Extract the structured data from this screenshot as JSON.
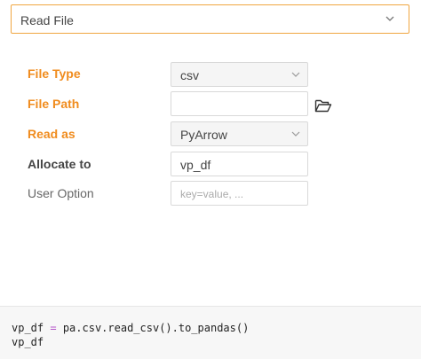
{
  "header": {
    "title": "Read File",
    "chevron_icon": "chevron-down-icon"
  },
  "form": {
    "file_type": {
      "label": "File Type",
      "value": "csv"
    },
    "file_path": {
      "label": "File Path",
      "value": "",
      "folder_icon": "folder-open-icon"
    },
    "read_as": {
      "label": "Read as",
      "value": "PyArrow"
    },
    "allocate_to": {
      "label": "Allocate to",
      "value": "vp_df"
    },
    "user_option": {
      "label": "User Option",
      "placeholder": "key=value, ..."
    }
  },
  "code": {
    "line1_lhs": "vp_df ",
    "line1_op": "=",
    "line1_rhs": " pa.csv.read_csv().to_pandas()",
    "line2": "vp_df"
  },
  "colors": {
    "accent": "#f08c1e",
    "header_border": "#f0a640",
    "operator": "#b455c8"
  }
}
